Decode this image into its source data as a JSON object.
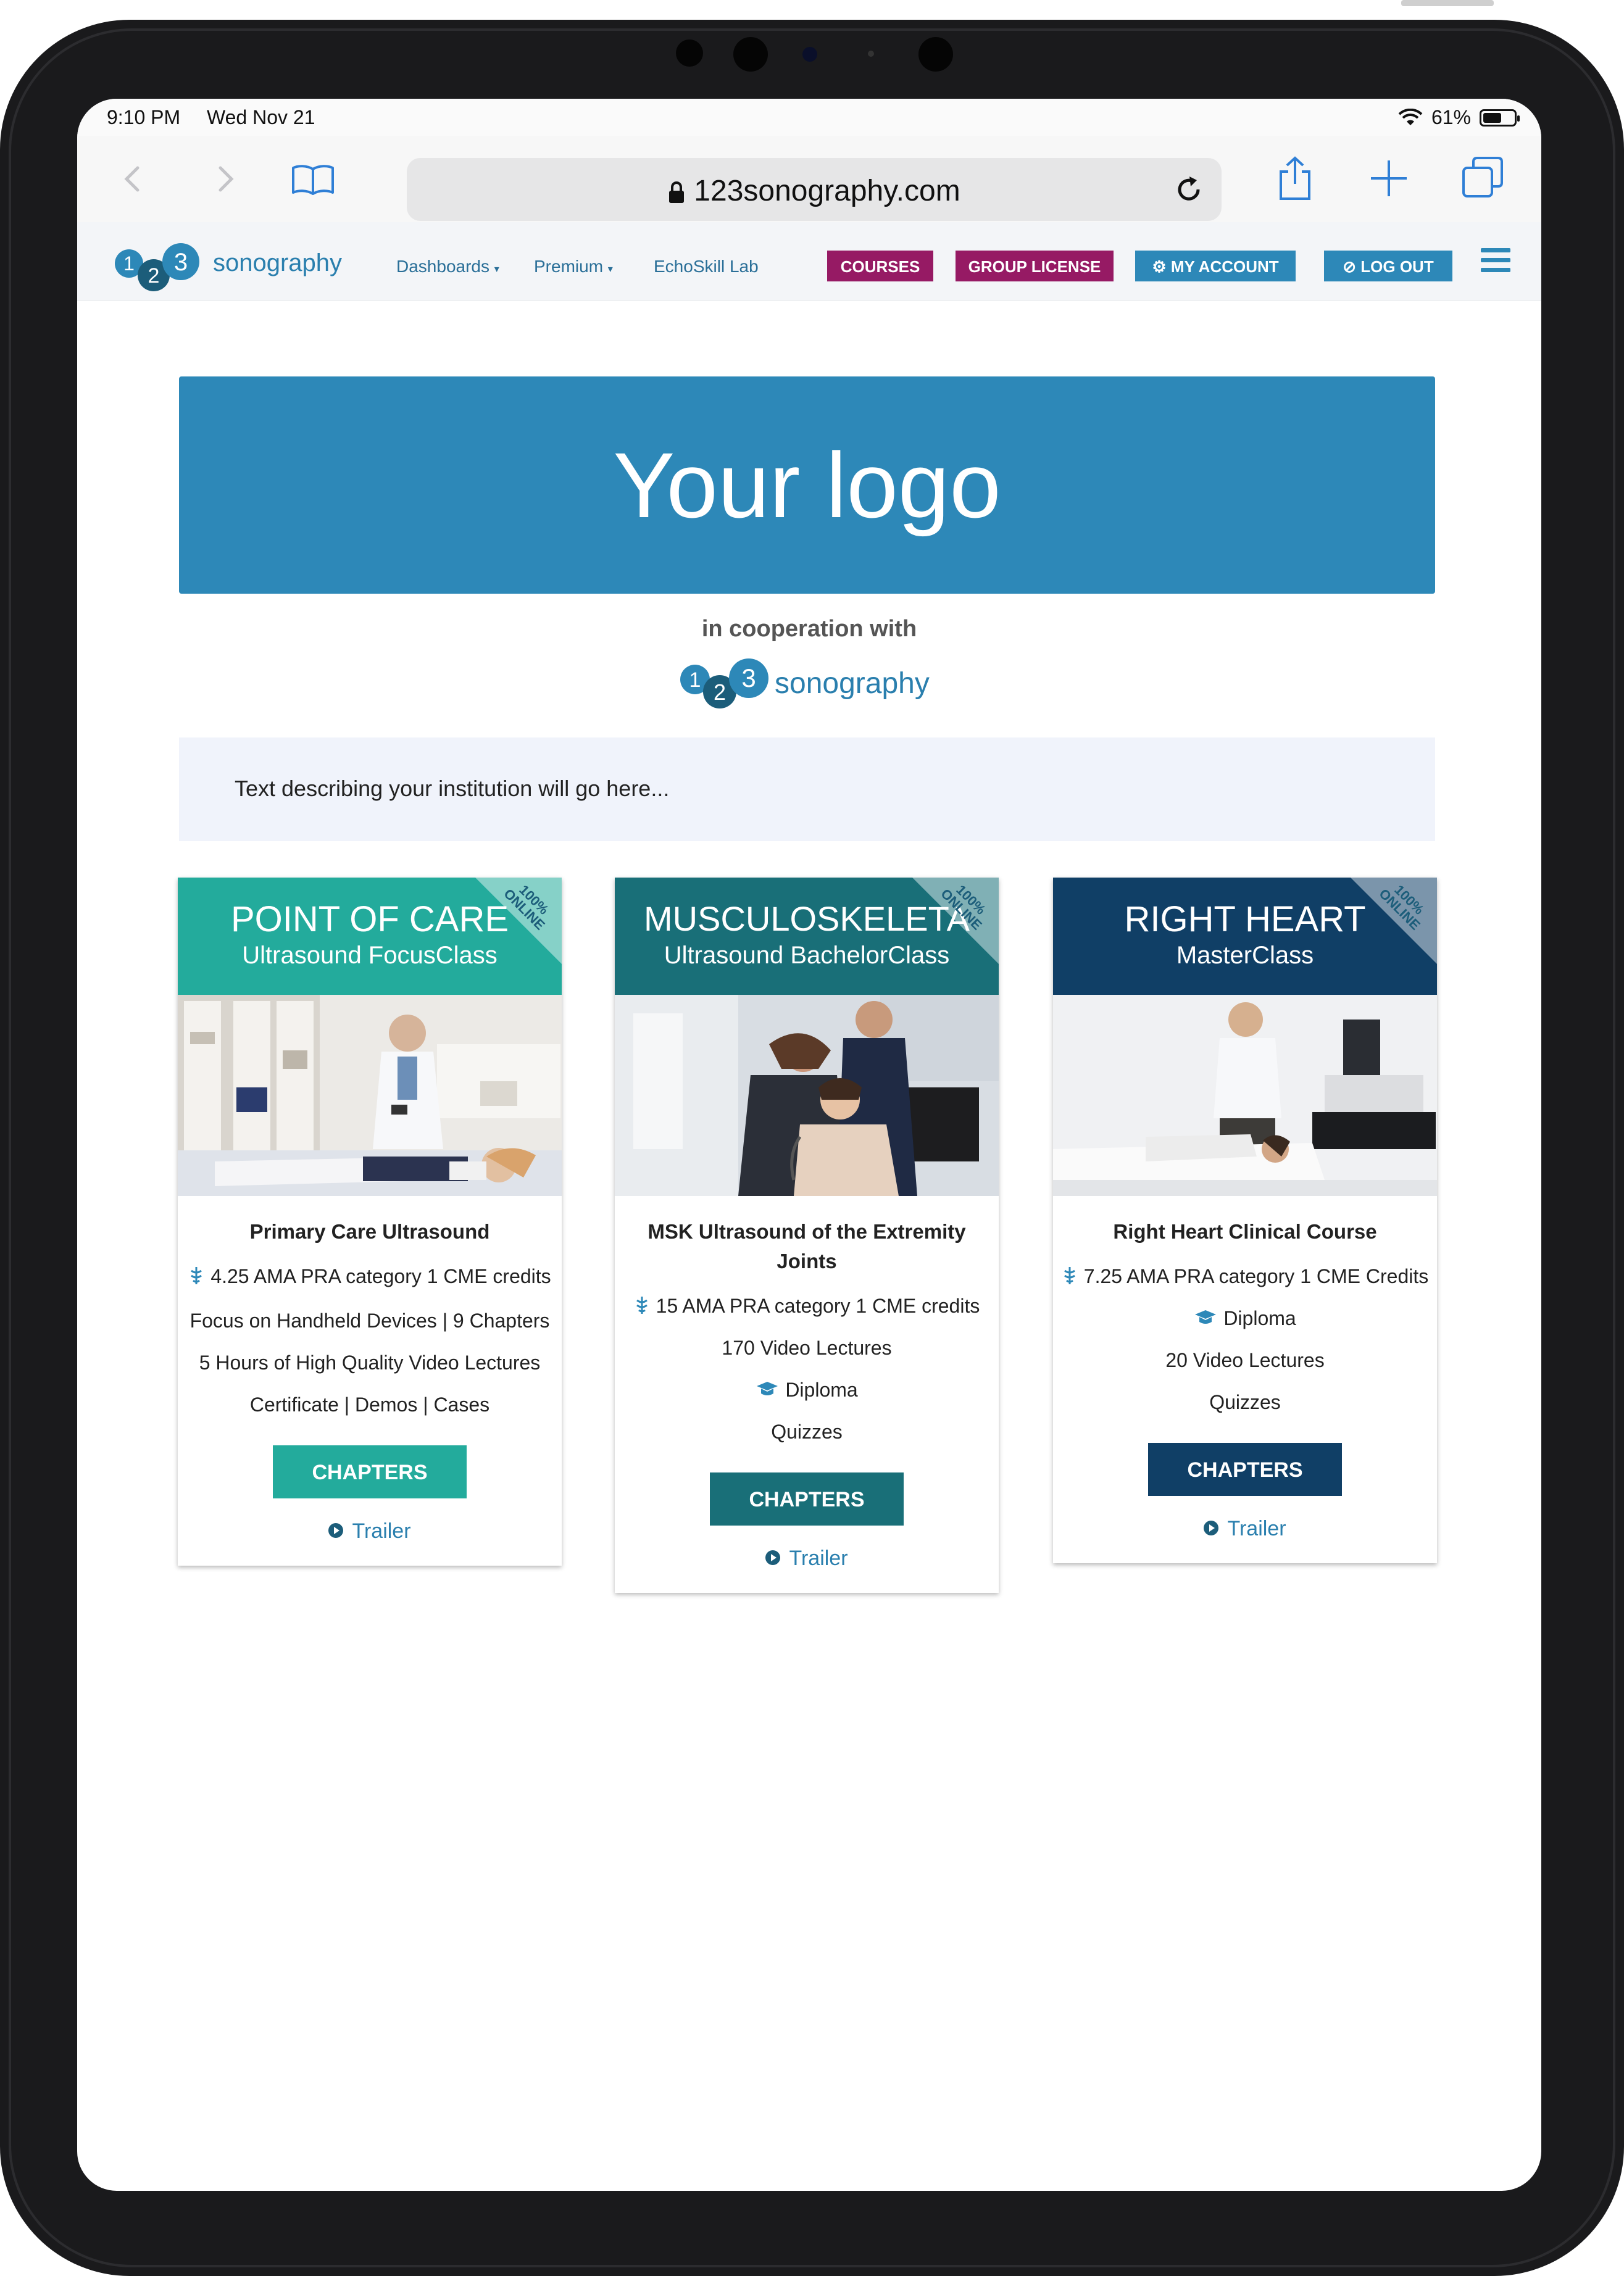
{
  "status_bar": {
    "time": "9:10 PM",
    "date": "Wed Nov 21",
    "battery": "61%",
    "battery_level": 0.61
  },
  "browser": {
    "url": "123sonography.com"
  },
  "site_nav": {
    "brand": {
      "digits": [
        "1",
        "2",
        "3"
      ],
      "text": "sonography"
    },
    "links": [
      "Dashboards",
      "Premium",
      "EchoSkill Lab"
    ],
    "buttons": {
      "courses": "COURSES",
      "group_license": "GROUP LICENSE",
      "my_account": "MY ACCOUNT",
      "log_out": "LOG OUT"
    }
  },
  "banner": {
    "logo_text": "Your logo"
  },
  "cooperation": {
    "label": "in cooperation with",
    "brand_text": "sonography",
    "digits": [
      "1",
      "2",
      "3"
    ]
  },
  "institution": {
    "text": "Text describing your institution will go here..."
  },
  "cards": [
    {
      "title": "POINT OF CARE",
      "subtitle": "Ultrasound FocusClass",
      "ribbon": "100% ONLINE",
      "course_title": "Primary Care Ultrasound",
      "credits": "4.25 AMA PRA category 1 CME credits",
      "lines": [
        "Focus on Handheld Devices | 9 Chapters",
        "5 Hours of High Quality Video Lectures",
        "Certificate | Demos | Cases"
      ],
      "button": "CHAPTERS",
      "trailer": "Trailer",
      "colors": {
        "header": "#23ab9c",
        "button": "#23ab9c"
      }
    },
    {
      "title": "MUSCULOSKELETA",
      "subtitle": "Ultrasound BachelorClass",
      "ribbon": "100% ONLINE",
      "course_title": "MSK Ultrasound of the Extremity Joints",
      "credits": "15 AMA PRA category 1 CME credits",
      "lines": [
        "170 Video Lectures",
        "Diploma",
        "Quizzes"
      ],
      "button": "CHAPTERS",
      "trailer": "Trailer",
      "colors": {
        "header": "#196f78",
        "button": "#196f78"
      }
    },
    {
      "title": "RIGHT HEART",
      "subtitle": "MasterClass",
      "ribbon": "100% ONLINE",
      "course_title": "Right Heart Clinical Course",
      "credits": "7.25 AMA PRA category 1 CME Credits",
      "lines": [
        "Diploma",
        "20 Video Lectures",
        "Quizzes"
      ],
      "button": "CHAPTERS",
      "trailer": "Trailer",
      "colors": {
        "header": "#103f66",
        "button": "#103f66"
      }
    }
  ],
  "colors": {
    "accent_blue": "#2d88b8",
    "magenta": "#961a64"
  },
  "icons": {
    "credits": "caduceus-icon",
    "diploma": "graduation-cap-icon",
    "trailer": "play-icon"
  }
}
